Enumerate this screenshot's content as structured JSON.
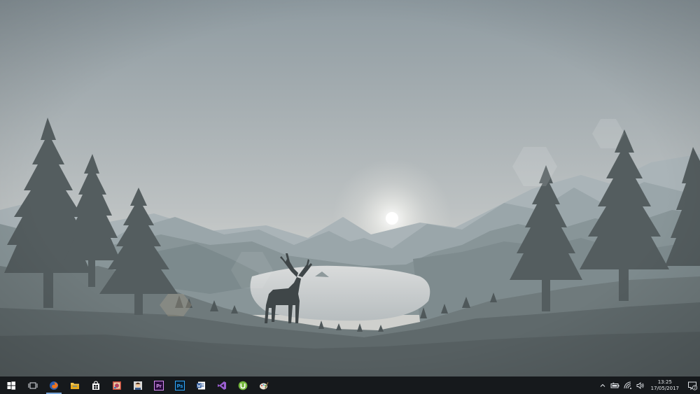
{
  "desktop": {
    "wallpaper": "deer-lake-mountains-wallpaper"
  },
  "taskbar": {
    "start_icon": "windows-logo-icon",
    "task_view_icon": "task-view-icon",
    "apps": [
      {
        "name": "firefox",
        "icon": "firefox-icon",
        "state": "running"
      },
      {
        "name": "file-explorer",
        "icon": "folder-icon",
        "state": "pinned"
      },
      {
        "name": "store",
        "icon": "store-icon",
        "state": "pinned"
      },
      {
        "name": "app-4",
        "icon": "colorful-app-icon",
        "state": "pinned"
      },
      {
        "name": "app-5",
        "icon": "face-app-icon",
        "state": "pinned"
      },
      {
        "name": "premiere",
        "icon": "premiere-icon",
        "label": "Pr",
        "state": "pinned"
      },
      {
        "name": "photoshop",
        "icon": "photoshop-icon",
        "label": "Ps",
        "state": "pinned"
      },
      {
        "name": "word",
        "icon": "word-icon",
        "state": "pinned"
      },
      {
        "name": "visual-studio",
        "icon": "visual-studio-icon",
        "state": "pinned"
      },
      {
        "name": "utorrent",
        "icon": "utorrent-icon",
        "state": "pinned"
      },
      {
        "name": "paint",
        "icon": "paint-icon",
        "state": "pinned"
      }
    ],
    "tray": {
      "icons": [
        "chevron-up-icon",
        "battery-icon",
        "wifi-icon",
        "volume-icon"
      ],
      "time": "13:25",
      "date": "17/05/2017",
      "notification_count": "2"
    }
  },
  "colors": {
    "taskbar": "#16191c",
    "accent": "#7aa6d8"
  }
}
